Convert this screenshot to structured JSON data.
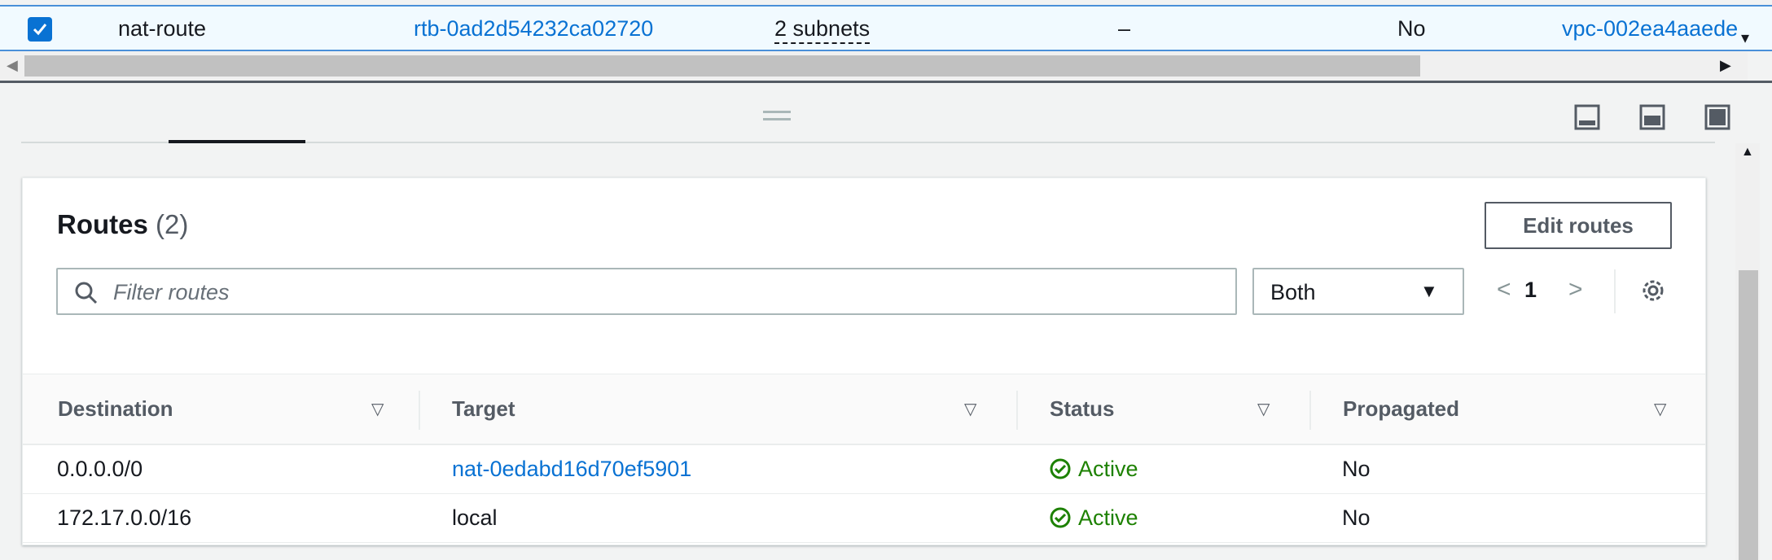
{
  "selected_row": {
    "name": "nat-route",
    "route_table_id": "rtb-0ad2d54232ca02720",
    "subnet_associations": "2 subnets",
    "edge_associations": "–",
    "main": "No",
    "vpc": "vpc-002ea4aaede"
  },
  "routes_panel": {
    "title": "Routes",
    "count": "(2)",
    "edit_button": "Edit routes",
    "filter_placeholder": "Filter routes",
    "select_value": "Both",
    "page": "1",
    "columns": [
      "Destination",
      "Target",
      "Status",
      "Propagated"
    ],
    "rows": [
      {
        "destination": "0.0.0.0/0",
        "target": "nat-0edabd16d70ef5901",
        "status": "Active",
        "propagated": "No"
      },
      {
        "destination": "172.17.0.0/16",
        "target": "local",
        "status": "Active",
        "propagated": "No"
      }
    ]
  },
  "colors": {
    "link": "#0972d3",
    "success": "#1d8102",
    "selected_row_bg": "#f1faff",
    "selected_row_border": "#4a90d9"
  },
  "icons": [
    "check-icon",
    "search-icon",
    "caret-down-icon",
    "chevron-left-icon",
    "chevron-right-icon",
    "settings-icon",
    "status-success-icon",
    "sort-icon",
    "panel-layout-icon"
  ]
}
